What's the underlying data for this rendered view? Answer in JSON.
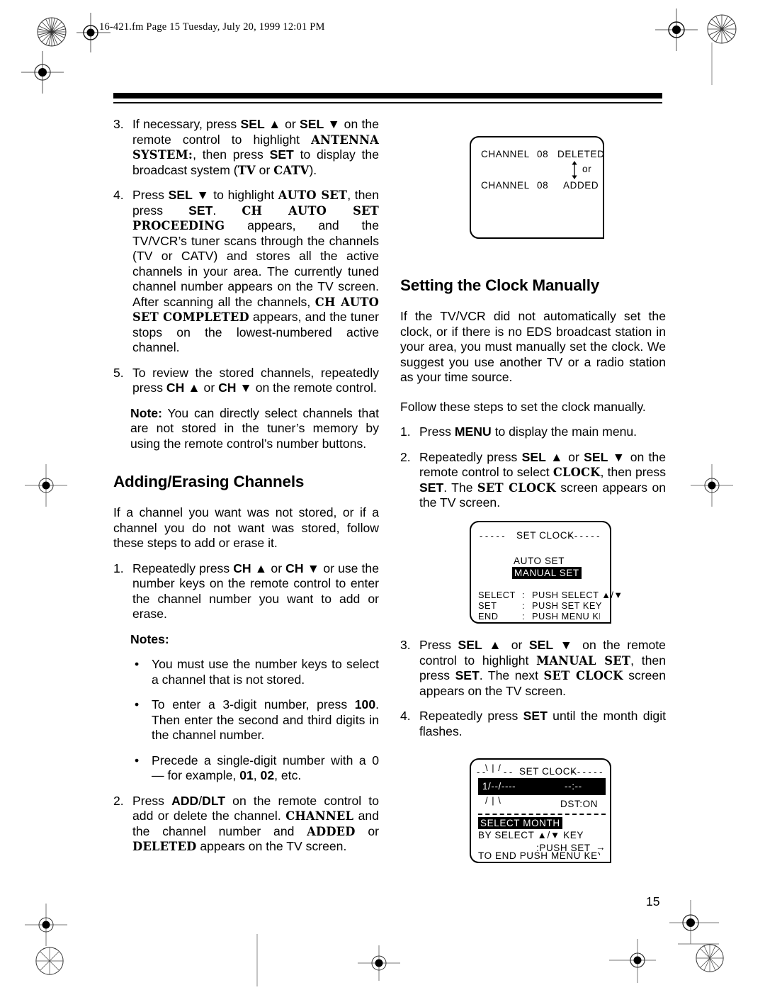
{
  "header": {
    "running_head": "16-421.fm  Page 15  Tuesday, July 20, 1999  12:01 PM"
  },
  "page_number": "15",
  "left_column": {
    "steps": [
      {
        "number": "3.",
        "segments": [
          {
            "t": "If necessary, press ",
            "s": "normal"
          },
          {
            "t": "SEL",
            "s": "bold"
          },
          {
            "t": " ▲ or ",
            "s": "normal"
          },
          {
            "t": "SEL",
            "s": "bold"
          },
          {
            "t": " ▼ on the remote control to highlight ",
            "s": "normal"
          },
          {
            "t": "ANTENNA SYSTEM:",
            "s": "osd"
          },
          {
            "t": ", then press ",
            "s": "normal"
          },
          {
            "t": "SET",
            "s": "bold"
          },
          {
            "t": " to display the broadcast system (",
            "s": "normal"
          },
          {
            "t": "TV",
            "s": "osd"
          },
          {
            "t": " or ",
            "s": "normal"
          },
          {
            "t": "CATV",
            "s": "osd"
          },
          {
            "t": ").",
            "s": "normal"
          }
        ]
      },
      {
        "number": "4.",
        "segments": [
          {
            "t": "Press ",
            "s": "normal"
          },
          {
            "t": "SEL",
            "s": "bold"
          },
          {
            "t": " ▼ to highlight ",
            "s": "normal"
          },
          {
            "t": "AUTO SET",
            "s": "osd"
          },
          {
            "t": ", then press ",
            "s": "normal"
          },
          {
            "t": "SET",
            "s": "bold"
          },
          {
            "t": ". ",
            "s": "normal"
          },
          {
            "t": "CH AUTO SET PROCEEDING",
            "s": "osd"
          },
          {
            "t": " appears, and the TV/VCR’s tuner scans through the channels (TV or CATV) and stores all the active channels in your area. The currently tuned channel number appears on the TV screen. After scanning all the channels, ",
            "s": "normal"
          },
          {
            "t": "CH AUTO SET COMPLETED",
            "s": "osd"
          },
          {
            "t": " appears, and the tuner stops on the lowest-numbered active channel.",
            "s": "normal"
          }
        ]
      },
      {
        "number": "5.",
        "segments": [
          {
            "t": "To review the stored channels, repeatedly press ",
            "s": "normal"
          },
          {
            "t": "CH",
            "s": "bold"
          },
          {
            "t": " ▲ or ",
            "s": "normal"
          },
          {
            "t": "CH",
            "s": "bold"
          },
          {
            "t": " ▼ on the remote control.",
            "s": "normal"
          }
        ]
      }
    ],
    "note": {
      "label": "Note:",
      "text": " You can directly select channels that are not stored in the tuner’s memory by using the remote control’s number buttons."
    },
    "heading": "Adding/Erasing Channels",
    "intro": "If a channel you want was not stored, or if a channel you do not want was stored, follow these steps to add or erase it.",
    "steps2": [
      {
        "number": "1.",
        "segments": [
          {
            "t": "Repeatedly press ",
            "s": "normal"
          },
          {
            "t": "CH",
            "s": "bold"
          },
          {
            "t": " ▲ or ",
            "s": "normal"
          },
          {
            "t": "CH",
            "s": "bold"
          },
          {
            "t": " ▼ or use the number keys on the remote control to enter the channel number you want to add or erase.",
            "s": "normal"
          }
        ]
      }
    ],
    "notes_heading": "Notes:",
    "bullets": [
      {
        "marker": "•",
        "segments": [
          {
            "t": "You must use the number keys to select a channel that is not stored.",
            "s": "normal"
          }
        ]
      },
      {
        "marker": "•",
        "segments": [
          {
            "t": "To enter a 3-digit number, press ",
            "s": "normal"
          },
          {
            "t": "100",
            "s": "bold"
          },
          {
            "t": ". Then enter the second and third digits in the channel number.",
            "s": "normal"
          }
        ]
      },
      {
        "marker": "•",
        "segments": [
          {
            "t": "Precede a single-digit number with a 0 — for example, ",
            "s": "normal"
          },
          {
            "t": "01",
            "s": "bold"
          },
          {
            "t": ", ",
            "s": "normal"
          },
          {
            "t": "02",
            "s": "bold"
          },
          {
            "t": ", etc.",
            "s": "normal"
          }
        ]
      }
    ],
    "steps3": [
      {
        "number": "2.",
        "segments": [
          {
            "t": "Press ",
            "s": "normal"
          },
          {
            "t": "ADD",
            "s": "bold"
          },
          {
            "t": "/",
            "s": "normal"
          },
          {
            "t": "DLT",
            "s": "bold"
          },
          {
            "t": " on the remote control to add or delete the channel. ",
            "s": "normal"
          },
          {
            "t": "CHANNEL",
            "s": "osd"
          },
          {
            "t": " and the channel number and ",
            "s": "normal"
          },
          {
            "t": "ADDED",
            "s": "osd"
          },
          {
            "t": " or ",
            "s": "normal"
          },
          {
            "t": "DELETED",
            "s": "osd"
          },
          {
            "t": " appears on the TV screen.",
            "s": "normal"
          }
        ]
      }
    ]
  },
  "right_column": {
    "heading": "Setting the Clock Manually",
    "intro1": "If the TV/VCR did not automatically set the clock, or if there is no EDS broadcast station in your area, you must manually set the clock. We suggest you use another TV or a radio station as your time source.",
    "intro2": "Follow these steps to set the clock manually.",
    "steps": [
      {
        "number": "1.",
        "segments": [
          {
            "t": "Press ",
            "s": "normal"
          },
          {
            "t": "MENU",
            "s": "bold"
          },
          {
            "t": " to display the main menu.",
            "s": "normal"
          }
        ]
      },
      {
        "number": "2.",
        "segments": [
          {
            "t": "Repeatedly press ",
            "s": "normal"
          },
          {
            "t": "SEL",
            "s": "bold"
          },
          {
            "t": " ▲ or ",
            "s": "normal"
          },
          {
            "t": "SEL",
            "s": "bold"
          },
          {
            "t": " ▼ on the remote control to select ",
            "s": "normal"
          },
          {
            "t": "CLOCK",
            "s": "osd"
          },
          {
            "t": ", then press ",
            "s": "normal"
          },
          {
            "t": "SET",
            "s": "bold"
          },
          {
            "t": ". The ",
            "s": "normal"
          },
          {
            "t": "SET CLOCK",
            "s": "osd"
          },
          {
            "t": " screen appears on the TV screen.",
            "s": "normal"
          }
        ]
      }
    ],
    "steps2": [
      {
        "number": "3.",
        "segments": [
          {
            "t": "Press ",
            "s": "normal"
          },
          {
            "t": "SEL",
            "s": "bold"
          },
          {
            "t": " ▲ or ",
            "s": "normal"
          },
          {
            "t": "SEL",
            "s": "bold"
          },
          {
            "t": " ▼ on the remote control to highlight ",
            "s": "normal"
          },
          {
            "t": "MANUAL SET",
            "s": "osd"
          },
          {
            "t": ", then press ",
            "s": "normal"
          },
          {
            "t": "SET",
            "s": "bold"
          },
          {
            "t": ". The next ",
            "s": "normal"
          },
          {
            "t": "SET CLOCK",
            "s": "osd"
          },
          {
            "t": " screen appears on the TV screen.",
            "s": "normal"
          }
        ]
      },
      {
        "number": "4.",
        "segments": [
          {
            "t": "Repeatedly press ",
            "s": "normal"
          },
          {
            "t": "SET",
            "s": "bold"
          },
          {
            "t": " until the month digit flashes.",
            "s": "normal"
          }
        ]
      }
    ]
  },
  "figures": {
    "channel_screen": {
      "line1_a": "CHANNEL",
      "line1_b": "08",
      "line1_c": "DELETED",
      "or_label": "or",
      "line2_a": "CHANNEL",
      "line2_b": "08",
      "line2_c": "ADDED"
    },
    "set_clock_menu": {
      "title": "SET CLOCK",
      "dash_left": "- - - - -",
      "dash_right": "- - - - - -",
      "option_auto": "AUTO  SET",
      "option_manual": "MANUAL  SET",
      "rows": [
        {
          "key": "SELECT",
          "colon": ":",
          "value": "PUSH  SELECT  ▲/▼"
        },
        {
          "key": "SET",
          "colon": ":",
          "value": "PUSH  SET  KEY"
        },
        {
          "key": "END",
          "colon": ":",
          "value": "PUSH  MENU  KEY"
        }
      ]
    },
    "set_clock_month": {
      "title": "SET CLOCK",
      "dash_left": "- -",
      "dash_mid": "- -",
      "dash_right": "- - - - - -",
      "flash_top": "\\ | /",
      "flash_bottom": "/ | \\",
      "date_month": "1",
      "date_rest": "/--/----",
      "time": "--:--",
      "dst": "DST:ON",
      "select_month": "SELECT MONTH",
      "by_select": "BY  SELECT  ▲/▼  KEY",
      "push_set": ":PUSH  SET",
      "arrow": "→",
      "to_end": "TO  END  PUSH  MENU  KEY"
    }
  }
}
